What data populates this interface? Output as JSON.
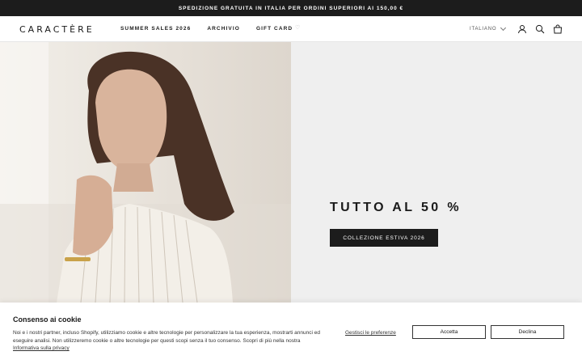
{
  "announcement": "SPEDIZIONE GRATUITA IN ITALIA PER ORDINI SUPERIORI AI 150,00 €",
  "header": {
    "logo": "CARACTÈRE",
    "nav": [
      "SUMMER SALES 2026",
      "ARCHIVIO",
      "GIFT CARD"
    ],
    "language": "ITALIANO"
  },
  "hero": {
    "title": "TUTTO AL 50 %",
    "button": "COLLEZIONE ESTIVA 2026"
  },
  "cookie": {
    "title": "Consenso ai cookie",
    "text": "Noi e i nostri partner, incluso Shopify, utilizziamo cookie e altre tecnologie per personalizzare la tua esperienza, mostrarti annunci ed eseguire analisi. Non utilizzeremo cookie o altre tecnologie per questi scopi senza il tuo consenso. Scopri di più nella nostra",
    "link": "Informativa sulla privacy",
    "manage": "Gestisci le preferenze",
    "accept": "Accetta",
    "decline": "Declina"
  },
  "icons": [
    "heart-icon",
    "user-icon",
    "search-icon",
    "bag-icon",
    "chevron-down-icon"
  ]
}
